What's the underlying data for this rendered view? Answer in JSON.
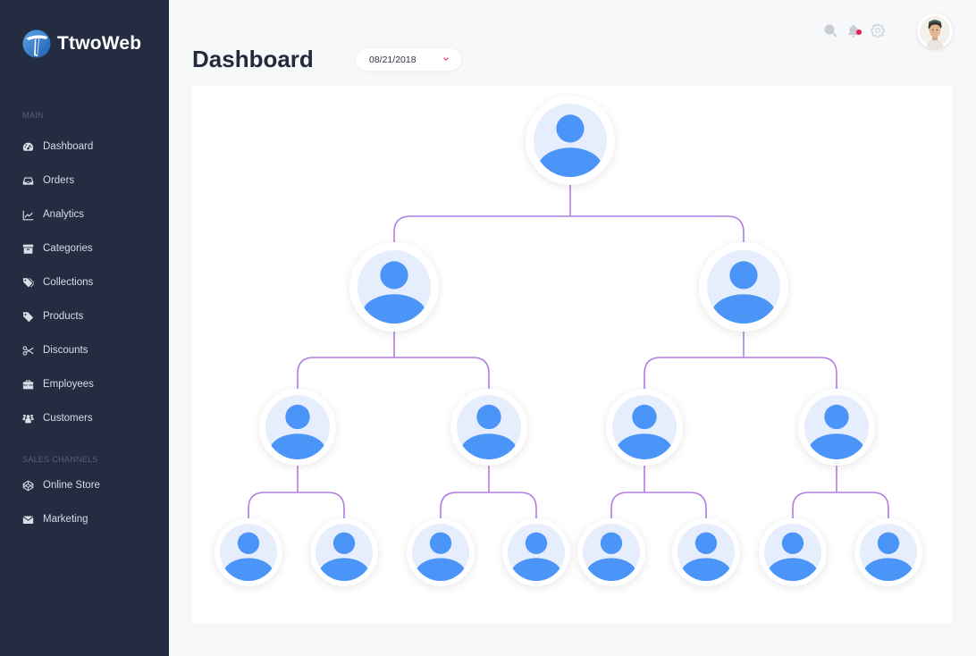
{
  "app": {
    "brand": "TtwoWeb",
    "page_title": "Dashboard"
  },
  "sidebar": {
    "sections": [
      {
        "label": "MAIN",
        "items": [
          {
            "label": "Dashboard",
            "icon": "dashboard-gauge-icon"
          },
          {
            "label": "Orders",
            "icon": "inbox-icon"
          },
          {
            "label": "Analytics",
            "icon": "line-chart-icon"
          },
          {
            "label": "Categories",
            "icon": "archive-box-icon"
          },
          {
            "label": "Collections",
            "icon": "tags-icon"
          },
          {
            "label": "Products",
            "icon": "tag-icon"
          },
          {
            "label": "Discounts",
            "icon": "scissors-icon"
          },
          {
            "label": "Employees",
            "icon": "briefcase-icon"
          },
          {
            "label": "Customers",
            "icon": "users-icon"
          }
        ]
      },
      {
        "label": "SALES CHANNELS",
        "items": [
          {
            "label": "Online Store",
            "icon": "codepen-cube-icon"
          },
          {
            "label": "Marketing",
            "icon": "envelope-icon"
          }
        ]
      }
    ]
  },
  "header": {
    "date_filter": {
      "value": "08/21/2018"
    },
    "icons": [
      "search-icon",
      "bell-icon",
      "gear-icon"
    ],
    "has_notification": true
  },
  "org_chart": {
    "node_icon": "user-avatar-icon",
    "colors": {
      "connector": "#b07ee0",
      "avatar_fg": "#4a95f7",
      "avatar_bg": "#e6edfc",
      "notification": "#e3204f"
    },
    "levels": [
      1,
      2,
      4,
      8
    ],
    "node_count": 15
  }
}
